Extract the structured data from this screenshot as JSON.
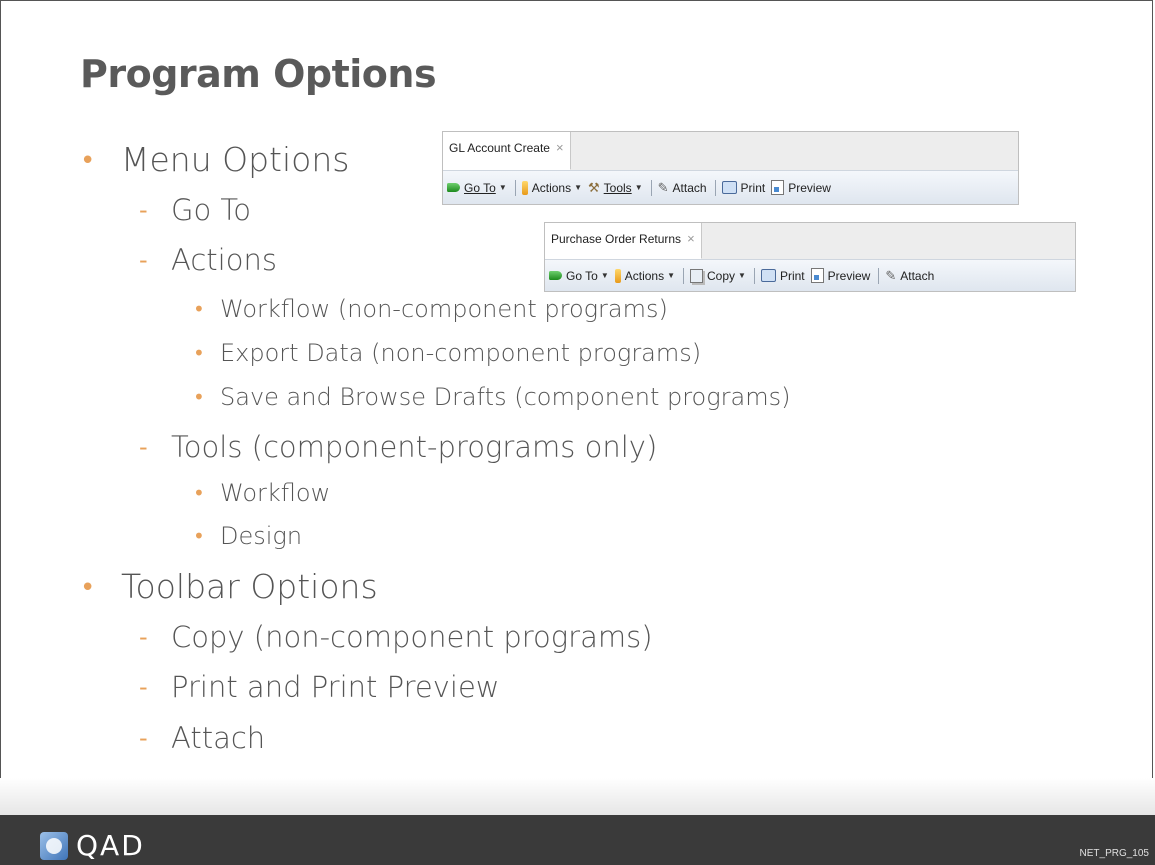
{
  "slide": {
    "title": "Program Options",
    "footer_code": "NET_PRG_105",
    "logo_text": "QAD"
  },
  "outline": [
    {
      "level": 1,
      "text": "Menu Options"
    },
    {
      "level": 2,
      "text": "Go To"
    },
    {
      "level": 2,
      "text": "Actions"
    },
    {
      "level": 3,
      "text": "Workflow (non-component programs)"
    },
    {
      "level": 3,
      "text": "Export Data  (non-component programs)"
    },
    {
      "level": 3,
      "text": "Save and Browse Drafts (component programs)"
    },
    {
      "level": 2,
      "text": "Tools (component-programs only)"
    },
    {
      "level": 3,
      "text": "Workflow"
    },
    {
      "level": 3,
      "text": "Design"
    },
    {
      "level": 1,
      "text": "Toolbar Options"
    },
    {
      "level": 2,
      "text": "Copy (non-component programs)"
    },
    {
      "level": 2,
      "text": "Print and Print Preview"
    },
    {
      "level": 2,
      "text": "Attach"
    }
  ],
  "window1": {
    "tab_label": "GL Account Create",
    "close": "×",
    "toolbar": {
      "goto": "Go To",
      "actions": "Actions",
      "tools": "Tools",
      "attach": "Attach",
      "print": "Print",
      "preview": "Preview"
    }
  },
  "window2": {
    "tab_label": "Purchase Order Returns",
    "close": "×",
    "toolbar": {
      "goto": "Go To",
      "actions": "Actions",
      "copy": "Copy",
      "print": "Print",
      "preview": "Preview",
      "attach": "Attach"
    }
  },
  "colors": {
    "bullet": "#e8a15a",
    "text": "#555555",
    "footer": "#3a3a3a"
  }
}
